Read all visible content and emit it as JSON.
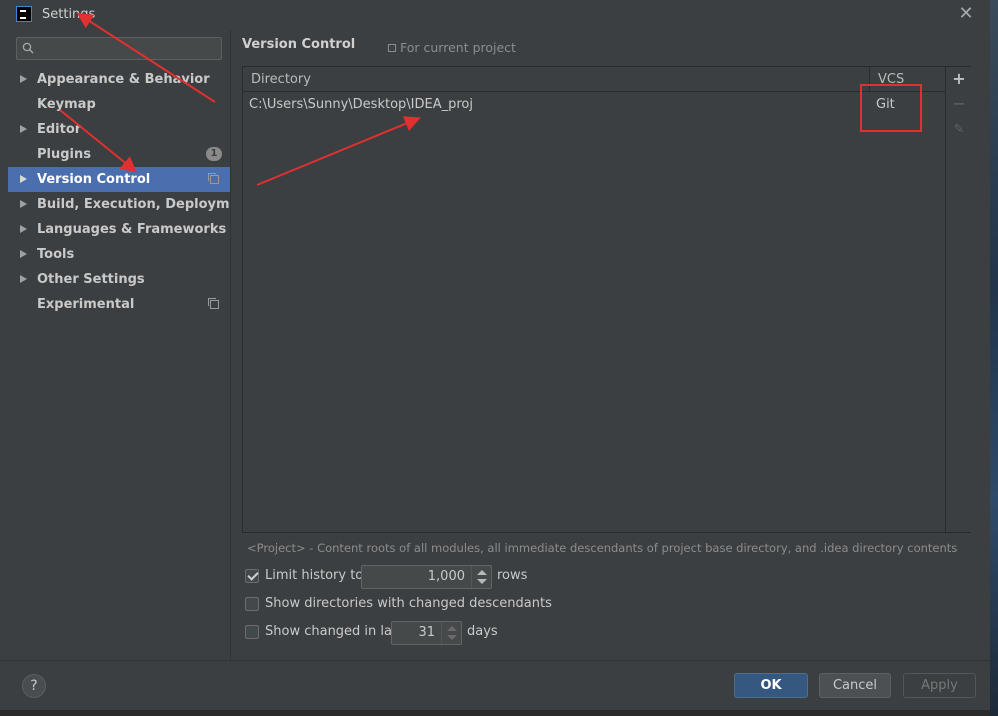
{
  "window": {
    "title": "Settings",
    "app_icon": "intellij-idea-icon",
    "close_glyph": "✕"
  },
  "sidebar": {
    "search": {
      "value": "",
      "placeholder": "",
      "icon": "search-icon"
    },
    "items": [
      {
        "label": "Appearance & Behavior",
        "expandable": true
      },
      {
        "label": "Keymap",
        "expandable": false
      },
      {
        "label": "Editor",
        "expandable": true
      },
      {
        "label": "Plugins",
        "expandable": false,
        "badge": "1"
      },
      {
        "label": "Version Control",
        "expandable": true,
        "selected": true,
        "project_icon": "project-scope-icon"
      },
      {
        "label": "Build, Execution, Deployment",
        "expandable": true
      },
      {
        "label": "Languages & Frameworks",
        "expandable": true
      },
      {
        "label": "Tools",
        "expandable": true
      },
      {
        "label": "Other Settings",
        "expandable": true
      },
      {
        "label": "Experimental",
        "expandable": false,
        "project_icon": "project-scope-icon"
      }
    ]
  },
  "main": {
    "title": "Version Control",
    "scope_label": "For current project",
    "table": {
      "columns": [
        "Directory",
        "VCS"
      ],
      "rows": [
        {
          "directory": "C:\\Users\\Sunny\\Desktop\\IDEA_proj",
          "vcs": "Git"
        }
      ],
      "toolbar": {
        "add": "+",
        "remove": "−",
        "edit": "✎"
      }
    },
    "hint": "<Project> - Content roots of all modules, all immediate descendants of project base directory, and .idea directory contents",
    "options": {
      "limit_history": {
        "label": "Limit history to:",
        "checked": true,
        "value": "1,000",
        "suffix": "rows"
      },
      "show_dirs": {
        "label": "Show directories with changed descendants",
        "checked": false
      },
      "show_changed": {
        "label": "Show changed in last",
        "checked": false,
        "value": "31",
        "suffix": "days"
      }
    }
  },
  "footer": {
    "help": "?",
    "ok": "OK",
    "cancel": "Cancel",
    "apply": "Apply"
  },
  "colors": {
    "background": "#3c3f41",
    "selection": "#4b6eaf",
    "ok_button": "#365880",
    "annotation": "#e03030"
  }
}
